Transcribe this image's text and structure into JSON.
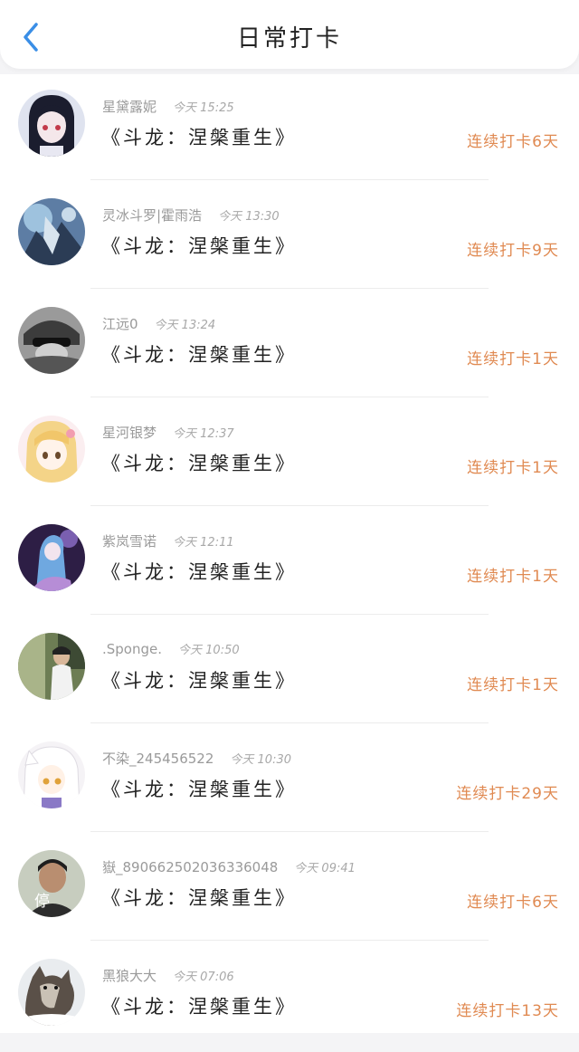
{
  "header": {
    "title": "日常打卡",
    "back_icon": "chevron-left-icon",
    "accent": "#3a8ee6"
  },
  "colors": {
    "streak": "#e08a52",
    "name": "#9a9a9a",
    "book": "#222222"
  },
  "entries": [
    {
      "user": "星黛露妮",
      "time": "今天 15:25",
      "book": "《斗龙：涅槃重生》",
      "streak": "连续打卡6天",
      "avatar": "anime-girl-dark-hair-avatar"
    },
    {
      "user": "灵冰斗罗|霍雨浩",
      "time": "今天 13:30",
      "book": "《斗龙：涅槃重生》",
      "streak": "连续打卡9天",
      "avatar": "anime-scene-blue-avatar"
    },
    {
      "user": "江远0",
      "time": "今天 13:24",
      "book": "《斗龙：涅槃重生》",
      "streak": "连续打卡1天",
      "avatar": "grayscale-character-avatar"
    },
    {
      "user": "星河银梦",
      "time": "今天 12:37",
      "book": "《斗龙：涅槃重生》",
      "streak": "连续打卡1天",
      "avatar": "anime-blonde-girl-avatar"
    },
    {
      "user": "紫岚雪诺",
      "time": "今天 12:11",
      "book": "《斗龙：涅槃重生》",
      "streak": "连续打卡1天",
      "avatar": "anime-purple-scene-avatar"
    },
    {
      "user": ".Sponge.",
      "time": "今天 10:50",
      "book": "《斗龙：涅槃重生》",
      "streak": "连续打卡1天",
      "avatar": "street-photo-avatar"
    },
    {
      "user": "不染_245456522",
      "time": "今天 10:30",
      "book": "《斗龙：涅槃重生》",
      "streak": "连续打卡29天",
      "avatar": "anime-white-hair-girl-avatar"
    },
    {
      "user": "嶽_890662502036336048",
      "time": "今天 09:41",
      "book": "《斗龙：涅槃重生》",
      "streak": "连续打卡6天",
      "avatar": "person-photo-avatar",
      "avatar_text": "停"
    },
    {
      "user": "黑狼大大",
      "time": "今天 07:06",
      "book": "《斗龙：涅槃重生》",
      "streak": "连续打卡13天",
      "avatar": "wolf-photo-avatar"
    }
  ]
}
